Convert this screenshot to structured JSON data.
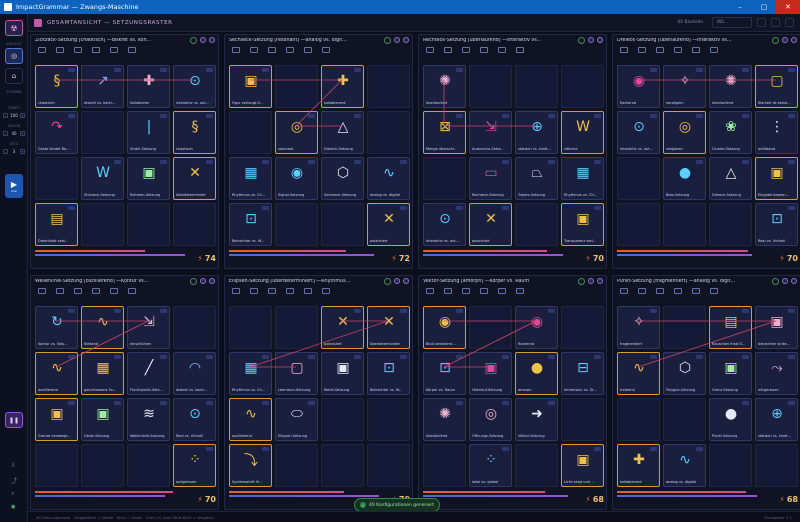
{
  "window": {
    "title": "ImpactGrammar — Zwangs-Maschine"
  },
  "header": {
    "title": "GESAMTANSICHT — SETZUNGSRASTER",
    "search_label": "40 Bauteile",
    "search_placeholder": "Wä..."
  },
  "sidebar": {
    "labels": [
      "ANSICHT",
      "FORMEN",
      "TEMPO",
      "ZEILEN",
      "BITS"
    ],
    "stepper_values": [
      "100",
      "40",
      "3"
    ],
    "play_sub": "live"
  },
  "panels": [
    {
      "title": "Zickzack-Setzung [chaotisch] —diskret vs. kon...",
      "score": "74",
      "cells": [
        {
          "row": 0,
          "col": 0,
          "label": "chaotisch",
          "glyph": "§",
          "color": "#f2c14a"
        },
        {
          "row": 0,
          "col": 1,
          "label": "diskret vs. konti...",
          "glyph": "↗",
          "color": "#7fb0ff"
        },
        {
          "row": 0,
          "col": 2,
          "label": "kollabieren",
          "glyph": "✚",
          "color": "#f0b0d0"
        },
        {
          "row": 0,
          "col": 3,
          "label": "interaktiv vs. aut...",
          "glyph": "⊙",
          "color": "#5ad0ff"
        },
        {
          "row": 1,
          "col": 0,
          "label": "Geste bindet Be...",
          "glyph": "↷",
          "color": "#e04a9a"
        },
        {
          "row": 1,
          "col": 2,
          "label": "Strahl-Setzung",
          "glyph": "|",
          "color": "#5ad0ff"
        },
        {
          "row": 1,
          "col": 3,
          "label": "chaotisch",
          "glyph": "§",
          "color": "#f2c14a"
        },
        {
          "row": 2,
          "col": 1,
          "label": "Zickzack-Setzung",
          "glyph": "W",
          "color": "#5ad0ff"
        },
        {
          "row": 2,
          "col": 2,
          "label": "Rahmen-Setzung",
          "glyph": "▣",
          "color": "#9af0a0"
        },
        {
          "row": 2,
          "col": 3,
          "label": "überdeterminiert",
          "glyph": "✕",
          "color": "#f2c14a"
        },
        {
          "row": 3,
          "col": 0,
          "label": "Datenblatt sebi...",
          "glyph": "▤",
          "color": "#f2c14a"
        }
      ]
    },
    {
      "title": "Sechseck-Setzung [resonant] —analog vs. digit...",
      "score": "72",
      "cells": [
        {
          "row": 0,
          "col": 0,
          "label": "Figur verlangt G...",
          "glyph": "▣",
          "color": "#f2c14a"
        },
        {
          "row": 0,
          "col": 2,
          "label": "kollabierend",
          "glyph": "✚",
          "color": "#f2c14a"
        },
        {
          "row": 1,
          "col": 1,
          "label": "resonant",
          "glyph": "◎",
          "color": "#f2c14a"
        },
        {
          "row": 1,
          "col": 2,
          "label": "Dreieck-Setzung",
          "glyph": "△",
          "color": "#e6e9f8"
        },
        {
          "row": 2,
          "col": 0,
          "label": "Rhythmus vs. Ch...",
          "glyph": "▦",
          "color": "#5ad0ff"
        },
        {
          "row": 2,
          "col": 1,
          "label": "Signal-Setzung",
          "glyph": "◉",
          "color": "#5ad0ff"
        },
        {
          "row": 2,
          "col": 2,
          "label": "Sechseck-Setzung",
          "glyph": "⬡",
          "color": "#e6e9f8"
        },
        {
          "row": 2,
          "col": 3,
          "label": "analog vs. digital",
          "glyph": "∿",
          "color": "#5ad0ff"
        },
        {
          "row": 3,
          "col": 0,
          "label": "Betrachter vs. W...",
          "glyph": "⊡",
          "color": "#5ad0ff"
        },
        {
          "row": 3,
          "col": 3,
          "label": "polarisiert",
          "glyph": "✕",
          "color": "#f2c14a"
        }
      ]
    },
    {
      "title": "Rechteck-Setzung [überlaufend] —interaktiv vs...",
      "score": "70",
      "cells": [
        {
          "row": 0,
          "col": 0,
          "label": "überlaufend",
          "glyph": "✺",
          "color": "#f0b0d0"
        },
        {
          "row": 1,
          "col": 0,
          "label": "Menge überschr...",
          "glyph": "⊠",
          "color": "#f2c14a"
        },
        {
          "row": 1,
          "col": 1,
          "label": "Ausbruchs-Setzu...",
          "glyph": "⇲",
          "color": "#e04a9a"
        },
        {
          "row": 1,
          "col": 2,
          "label": "statisch vs. kinet...",
          "glyph": "⊕",
          "color": "#5ad0ff"
        },
        {
          "row": 1,
          "col": 3,
          "label": "zitternd",
          "glyph": "W",
          "color": "#f2c14a"
        },
        {
          "row": 2,
          "col": 1,
          "label": "Rechteck-Setzung",
          "glyph": "▭",
          "color": "#e04a9a"
        },
        {
          "row": 2,
          "col": 2,
          "label": "Trapez-Setzung",
          "glyph": "⏢",
          "color": "#e6e9f8"
        },
        {
          "row": 2,
          "col": 3,
          "label": "Rhythmus vs. Ch...",
          "glyph": "▦",
          "color": "#5ad0ff"
        },
        {
          "row": 3,
          "col": 0,
          "label": "interaktiv vs. aut...",
          "glyph": "⊙",
          "color": "#5ad0ff"
        },
        {
          "row": 3,
          "col": 1,
          "label": "polarisiert",
          "glyph": "✕",
          "color": "#f2c14a"
        },
        {
          "row": 3,
          "col": 3,
          "label": "Transparenz verl...",
          "glyph": "▣",
          "color": "#f2c14a"
        }
      ]
    },
    {
      "title": "Dreieck-Setzung [überlaufend] —interaktiv vs...",
      "score": "70",
      "cells": [
        {
          "row": 0,
          "col": 0,
          "label": "flackernd",
          "glyph": "◉",
          "color": "#e04a9a"
        },
        {
          "row": 0,
          "col": 1,
          "label": "verzögern",
          "glyph": "✧",
          "color": "#f0b0d0"
        },
        {
          "row": 0,
          "col": 2,
          "label": "überlaufend",
          "glyph": "✺",
          "color": "#f0b0d0"
        },
        {
          "row": 0,
          "col": 3,
          "label": "Klarheit ist keine...",
          "glyph": "▢",
          "color": "#f2c14a"
        },
        {
          "row": 1,
          "col": 0,
          "label": "interaktiv vs. aut...",
          "glyph": "⊙",
          "color": "#5ad0ff"
        },
        {
          "row": 1,
          "col": 1,
          "label": "reagieren",
          "glyph": "◎",
          "color": "#f2c14a"
        },
        {
          "row": 1,
          "col": 2,
          "label": "Cluster-Setzung",
          "glyph": "❀",
          "color": "#9af0a0"
        },
        {
          "row": 1,
          "col": 3,
          "label": "auflösend",
          "glyph": "⋮",
          "color": "#e6e9f8"
        },
        {
          "row": 2,
          "col": 1,
          "label": "Blob-Setzung",
          "glyph": "●",
          "color": "#5ad0ff"
        },
        {
          "row": 2,
          "col": 2,
          "label": "Dreieck-Setzung",
          "glyph": "△",
          "color": "#e6e9f8"
        },
        {
          "row": 2,
          "col": 3,
          "label": "Eingabe begren...",
          "glyph": "▣",
          "color": "#f2c14a"
        },
        {
          "row": 3,
          "col": 3,
          "label": "Real vs. Virtuell",
          "glyph": "⊡",
          "color": "#5ad0ff"
        }
      ]
    },
    {
      "title": "Wellenlinie-Setzung [oszillierend] —Kontur vs...",
      "score": "70",
      "cells": [
        {
          "row": 0,
          "col": 0,
          "label": "Kontur vs. Volu...",
          "glyph": "↻",
          "color": "#5ad0ff"
        },
        {
          "row": 0,
          "col": 1,
          "label": "fließend",
          "glyph": "∿",
          "color": "#f2c14a"
        },
        {
          "row": 0,
          "col": 2,
          "label": "einschlühen",
          "glyph": "⇲",
          "color": "#f0b0d0"
        },
        {
          "row": 1,
          "col": 0,
          "label": "oszillierend",
          "glyph": "∿",
          "color": "#f2c14a"
        },
        {
          "row": 1,
          "col": 1,
          "label": "geschlossene Fo...",
          "glyph": "▦",
          "color": "#f2c14a"
        },
        {
          "row": 1,
          "col": 2,
          "label": "Fluchtpunkt-Setz...",
          "glyph": "╱",
          "color": "#e6e9f8"
        },
        {
          "row": 1,
          "col": 3,
          "label": "diskret vs. konti...",
          "glyph": "◠",
          "color": "#5ad0ff"
        },
        {
          "row": 2,
          "col": 0,
          "label": "Grenze verweige...",
          "glyph": "▣",
          "color": "#f2c14a"
        },
        {
          "row": 2,
          "col": 1,
          "label": "Gestz-Setzung",
          "glyph": "▣",
          "color": "#9af0a0"
        },
        {
          "row": 2,
          "col": 2,
          "label": "Wellenlinie-Setzung",
          "glyph": "≋",
          "color": "#e6e9f8"
        },
        {
          "row": 2,
          "col": 3,
          "label": "Real vs. Virtuell",
          "glyph": "⊙",
          "color": "#5ad0ff"
        },
        {
          "row": 3,
          "col": 3,
          "label": "aufgerissen",
          "glyph": "⁘",
          "color": "#f2c14a"
        }
      ]
    },
    {
      "title": "Ellipsen-Setzung [überdeterminiert] —Rhythmus...",
      "score": "70",
      "cells": [
        {
          "row": 0,
          "col": 2,
          "label": "polarisiert",
          "glyph": "✕",
          "color": "#f2c14a"
        },
        {
          "row": 0,
          "col": 3,
          "label": "überdeterminiert",
          "glyph": "✕",
          "color": "#f2c14a"
        },
        {
          "row": 1,
          "col": 0,
          "label": "Rhythmus vs. Ch...",
          "glyph": "▦",
          "color": "#5ad0ff"
        },
        {
          "row": 1,
          "col": 1,
          "label": "Leerraum-Setzung",
          "glyph": "▢",
          "color": "#f0b0d0"
        },
        {
          "row": 1,
          "col": 2,
          "label": "Relief-Setzung",
          "glyph": "▣",
          "color": "#e6e9f8"
        },
        {
          "row": 1,
          "col": 3,
          "label": "Betrachter vs. W...",
          "glyph": "⊡",
          "color": "#5ad0ff"
        },
        {
          "row": 2,
          "col": 0,
          "label": "oszillierend",
          "glyph": "∿",
          "color": "#f2c14a"
        },
        {
          "row": 2,
          "col": 1,
          "label": "Ellipsen-Setzung",
          "glyph": "⬭",
          "color": "#e6e9f8"
        },
        {
          "row": 3,
          "col": 0,
          "label": "Synthesetritt Vi...",
          "glyph": "⤵",
          "color": "#f2c14a"
        }
      ]
    },
    {
      "title": "Vektor-Setzung [amorph] —Körper vs. Raum",
      "score": "68",
      "cells": [
        {
          "row": 0,
          "col": 0,
          "label": "Blick bestimmt ...",
          "glyph": "◉",
          "color": "#f2c14a"
        },
        {
          "row": 0,
          "col": 2,
          "label": "flackernd",
          "glyph": "◉",
          "color": "#e04a9a"
        },
        {
          "row": 1,
          "col": 0,
          "label": "Körper vs. Raum",
          "glyph": "⊡",
          "color": "#5ad0ff"
        },
        {
          "row": 1,
          "col": 1,
          "label": "Überlauf-Setzung",
          "glyph": "▣",
          "color": "#e04a9a"
        },
        {
          "row": 1,
          "col": 2,
          "label": "amorph",
          "glyph": "●",
          "color": "#f2c14a"
        },
        {
          "row": 1,
          "col": 3,
          "label": "Immersion vs. Di...",
          "glyph": "⊟",
          "color": "#5ad0ff"
        },
        {
          "row": 2,
          "col": 0,
          "label": "überlaufend",
          "glyph": "✺",
          "color": "#f0b0d0"
        },
        {
          "row": 2,
          "col": 1,
          "label": "Öffnungs-Setzung",
          "glyph": "◎",
          "color": "#f0b0d0"
        },
        {
          "row": 2,
          "col": 2,
          "label": "Vektor-Setzung",
          "glyph": "➜",
          "color": "#e6e9f8"
        },
        {
          "row": 3,
          "col": 1,
          "label": "lokal vs. global",
          "glyph": "⁘",
          "color": "#5ad0ff"
        },
        {
          "row": 3,
          "col": 3,
          "label": "Licht zeigt und ...",
          "glyph": "▣",
          "color": "#f2c14a"
        }
      ]
    },
    {
      "title": "Punkt-Setzung [fragmentiert] —analog vs. digit...",
      "score": "68",
      "cells": [
        {
          "row": 0,
          "col": 0,
          "label": "fragmentiert",
          "glyph": "✧",
          "color": "#f0b0d0"
        },
        {
          "row": 0,
          "col": 2,
          "label": "Rauschen frisst S...",
          "glyph": "▤",
          "color": "#f2c14a"
        },
        {
          "row": 0,
          "col": 3,
          "label": "betrachter sinke...",
          "glyph": "▣",
          "color": "#f0b0d0"
        },
        {
          "row": 1,
          "col": 0,
          "label": "treibend",
          "glyph": "∿",
          "color": "#f2c14a"
        },
        {
          "row": 1,
          "col": 1,
          "label": "Polygon-Setzung",
          "glyph": "⬡",
          "color": "#e6e9f8"
        },
        {
          "row": 1,
          "col": 2,
          "label": "Grenz-Setzung",
          "glyph": "▣",
          "color": "#9af0a0"
        },
        {
          "row": 1,
          "col": 3,
          "label": "mitgerissen",
          "glyph": "⤳",
          "color": "#f0b0d0"
        },
        {
          "row": 2,
          "col": 2,
          "label": "Punkt-Setzung",
          "glyph": "●",
          "color": "#e6e9f8"
        },
        {
          "row": 2,
          "col": 3,
          "label": "statisch vs. kinet...",
          "glyph": "⊕",
          "color": "#5ad0ff"
        },
        {
          "row": 3,
          "col": 0,
          "label": "kollabierend",
          "glyph": "✚",
          "color": "#f2c14a"
        },
        {
          "row": 3,
          "col": 1,
          "label": "analog vs. digital",
          "glyph": "∿",
          "color": "#5ad0ff"
        }
      ]
    }
  ],
  "toast": {
    "text": "40 Konfigurationen generiert"
  },
  "statusbar": {
    "left": "40 Setzungsraster · Doppelklick = Detail · Klick = Detail · Klick (2) oder Shift-Klick = Vergleich",
    "right": "ZuangsVer 2.1"
  },
  "colors": {
    "accent": "#1c58b3",
    "score": "#f0c070",
    "bar_warm": "#e3602a",
    "bar_cool": "#4a6ad8"
  }
}
